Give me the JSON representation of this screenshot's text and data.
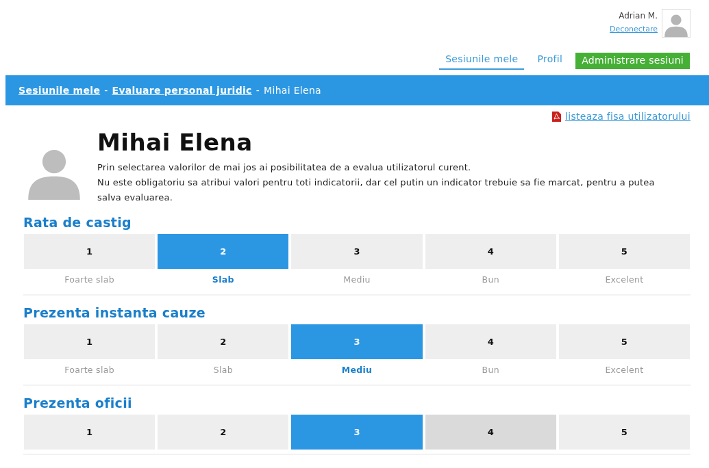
{
  "user": {
    "name": "Adrian M.",
    "logout": "Deconectare"
  },
  "nav": [
    {
      "label": "Sesiunile mele",
      "kind": "underline",
      "selected": true
    },
    {
      "label": "Profil",
      "kind": "link",
      "selected": false
    },
    {
      "label": "Administrare sesiuni",
      "kind": "button",
      "selected": false
    }
  ],
  "breadcrumb": [
    {
      "label": "Sesiunile mele",
      "kind": "link"
    },
    {
      "label": "-",
      "kind": "separator"
    },
    {
      "label": "Evaluare personal juridic",
      "kind": "link"
    },
    {
      "label": "-",
      "kind": "separator"
    },
    {
      "label": "Mihai Elena",
      "kind": "current"
    }
  ],
  "pdf_link": "listeaza fisa utilizatorului",
  "person": {
    "name": "Mihai Elena",
    "description": [
      "Prin selectarea valorilor de mai jos ai posibilitatea de a evalua utilizatorul curent.",
      "Nu este obligatoriu sa atribui valori pentru toti indicatorii, dar cel putin un indicator trebuie sa fie marcat, pentru a putea salva evaluarea."
    ]
  },
  "criteria": [
    {
      "title": "Rata de castig",
      "options": [
        {
          "value": "1",
          "label": "Foarte slab",
          "selected": false,
          "hovered": false
        },
        {
          "value": "2",
          "label": "Slab",
          "selected": true,
          "hovered": false
        },
        {
          "value": "3",
          "label": "Mediu",
          "selected": false,
          "hovered": false
        },
        {
          "value": "4",
          "label": "Bun",
          "selected": false,
          "hovered": false
        },
        {
          "value": "5",
          "label": "Excelent",
          "selected": false,
          "hovered": false
        }
      ]
    },
    {
      "title": "Prezenta instanta cauze",
      "options": [
        {
          "value": "1",
          "label": "Foarte slab",
          "selected": false,
          "hovered": false
        },
        {
          "value": "2",
          "label": "Slab",
          "selected": false,
          "hovered": false
        },
        {
          "value": "3",
          "label": "Mediu",
          "selected": true,
          "hovered": false
        },
        {
          "value": "4",
          "label": "Bun",
          "selected": false,
          "hovered": false
        },
        {
          "value": "5",
          "label": "Excelent",
          "selected": false,
          "hovered": false
        }
      ]
    },
    {
      "title": "Prezenta oficii",
      "options": [
        {
          "value": "1",
          "selected": false,
          "hovered": false
        },
        {
          "value": "2",
          "selected": false,
          "hovered": false
        },
        {
          "value": "3",
          "selected": true,
          "hovered": false
        },
        {
          "value": "4",
          "selected": false,
          "hovered": true
        },
        {
          "value": "5",
          "selected": false,
          "hovered": false
        }
      ]
    }
  ]
}
